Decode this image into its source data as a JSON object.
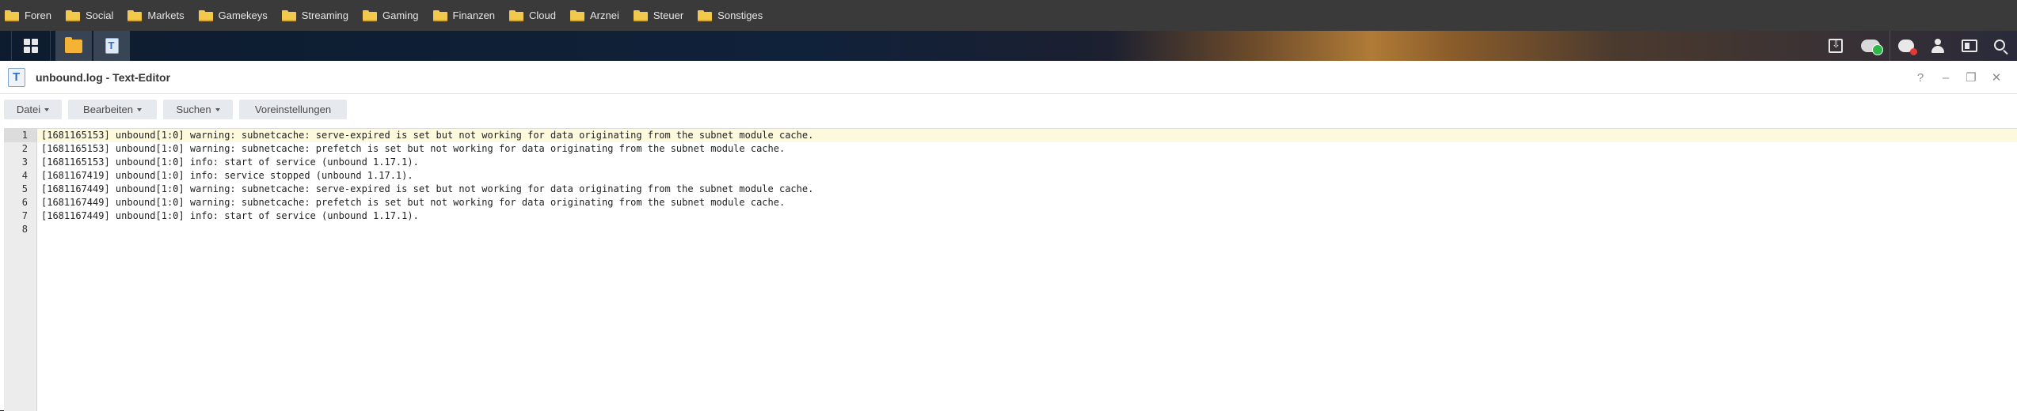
{
  "bookmarks": [
    "Foren",
    "Social",
    "Markets",
    "Gamekeys",
    "Streaming",
    "Gaming",
    "Finanzen",
    "Cloud",
    "Arznei",
    "Steuer",
    "Sonstiges"
  ],
  "taskbar": {
    "left_icons": [
      "main-menu-icon",
      "file-station-icon",
      "text-editor-icon"
    ],
    "right_icons": [
      "download-icon",
      "cloud-sync-icon",
      "chat-icon",
      "user-icon",
      "widgets-icon",
      "search-icon"
    ],
    "colors": {
      "cloud_status": "#2fb84a",
      "chat_badge": "#e53935"
    }
  },
  "window": {
    "title": "unbound.log - Text-Editor",
    "controls": {
      "help": "?",
      "minimize": "–",
      "restore": "❐",
      "close": "✕"
    }
  },
  "menu": {
    "file": "Datei",
    "edit": "Bearbeiten",
    "search": "Suchen",
    "settings": "Voreinstellungen"
  },
  "editor": {
    "active_line": 1,
    "lines": [
      "[1681165153] unbound[1:0] warning: subnetcache: serve-expired is set but not working for data originating from the subnet module cache.",
      "[1681165153] unbound[1:0] warning: subnetcache: prefetch is set but not working for data originating from the subnet module cache.",
      "[1681165153] unbound[1:0] info: start of service (unbound 1.17.1).",
      "[1681167419] unbound[1:0] info: service stopped (unbound 1.17.1).",
      "[1681167449] unbound[1:0] warning: subnetcache: serve-expired is set but not working for data originating from the subnet module cache.",
      "[1681167449] unbound[1:0] warning: subnetcache: prefetch is set but not working for data originating from the subnet module cache.",
      "[1681167449] unbound[1:0] info: start of service (unbound 1.17.1).",
      ""
    ],
    "line_numbers": [
      "1",
      "2",
      "3",
      "4",
      "5",
      "6",
      "7",
      "8"
    ],
    "active_line_color": "#fdf9dc"
  }
}
